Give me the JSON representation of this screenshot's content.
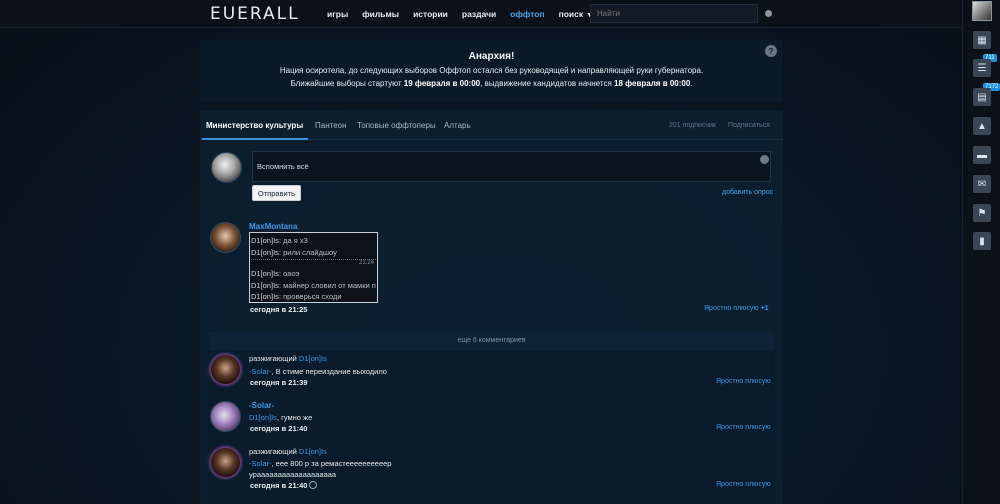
{
  "header": {
    "logo": "EUERALL",
    "nav": [
      {
        "label": "игры"
      },
      {
        "label": "фильмы"
      },
      {
        "label": "истории"
      },
      {
        "label": "раздачи"
      },
      {
        "label": "оффтоп"
      },
      {
        "label": "поиск"
      }
    ],
    "search_placeholder": "Найти"
  },
  "sidebar": {
    "badges": [
      "711",
      "7172"
    ]
  },
  "announcement": {
    "title": "Анархия!",
    "line1": "Нация осиротела, до следующих выборов Оффтоп остался без руководящей и направляющей руки губернатора.",
    "line2_pre": "Ближайшие выборы стартуют ",
    "line2_date1": "19 февраля в 00:00",
    "line2_mid": ", выдвижение кандидатов начнется ",
    "line2_date2": "18 февраля в 00:00",
    "line2_end": "."
  },
  "tabs": [
    "Министерство культуры",
    "Пантеон",
    "Топовые оффтоперы",
    "Алтарь"
  ],
  "subscribers": "201 подписчик",
  "subscribe_label": "Подписаться",
  "composer": {
    "text": "Вспомнить всё",
    "send_label": "Отправить",
    "add_poll": "добавить опрос"
  },
  "post": {
    "author": "MaxMontana",
    "quote": [
      {
        "nick": "D1[on]Is",
        "text": ": да я х3"
      },
      {
        "nick": "D1[on]Is",
        "text": ": рили слайдшоу"
      },
      {
        "nick": "D1[on]Is",
        "text": ": оаоэ"
      },
      {
        "nick": "D1[on]Is",
        "text": ": майнер словил от мамки пр"
      },
      {
        "nick": "D1[on]Is",
        "text": ": проверься сходи"
      }
    ],
    "quote_time": "21:24",
    "time": "сегодня в 21:25",
    "plus_label": "Яростно плюсую",
    "plus_count": "+1"
  },
  "more_comments": "еще 6 комментариев",
  "replies": [
    {
      "rank": "разжигающий",
      "author": "D1[on]Is",
      "mention": "-Solar-",
      "text": ", В стиме переиздание выходило",
      "text2": "",
      "time": "сегодня в 21:39",
      "plus_label": "Яростно плюсую"
    },
    {
      "rank": "",
      "author": "-Solar-",
      "mention": "D1[on]Is",
      "text": ", гумно же",
      "text2": "",
      "time": "сегодня в 21:40",
      "plus_label": "Яростно плюсую"
    },
    {
      "rank": "разжигающий",
      "author": "D1[on]Is",
      "mention": "-Solar-",
      "text": ", еее 800 р за ремастеееееееееер",
      "text2": "урааааааааааааааааааа",
      "time": "сегодня в 21:40",
      "plus_label": "Яростно плюсую"
    }
  ]
}
